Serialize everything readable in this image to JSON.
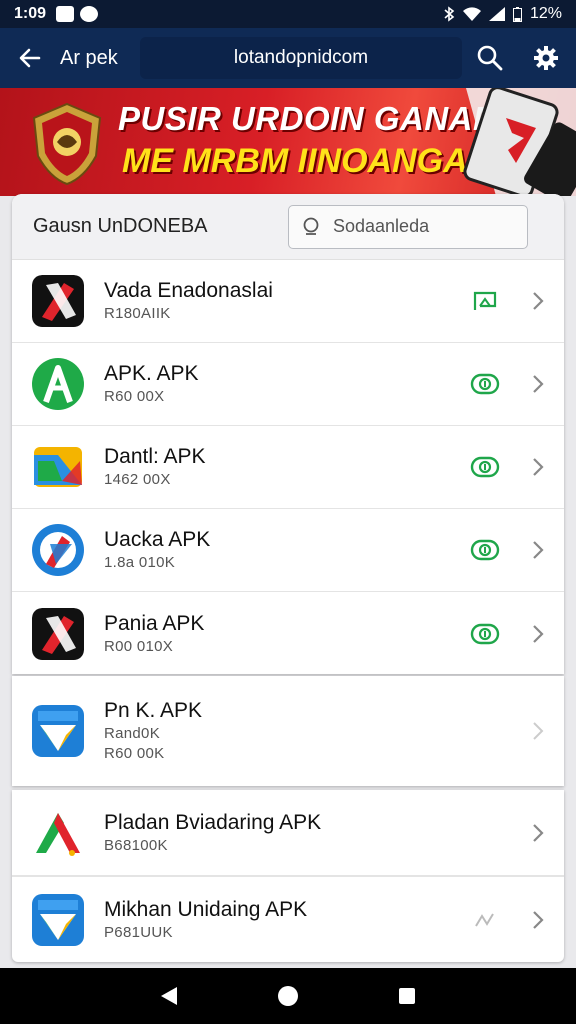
{
  "status_bar": {
    "time": "1:09",
    "battery": "12%"
  },
  "app_bar": {
    "title": "Ar pek",
    "url": "lotandopnidcom"
  },
  "banner": {
    "line1": "PUSIR URDOIN GANAN",
    "line2": "ME MRBM IINOANGA!"
  },
  "section": {
    "title": "Gausn UnDONEBA",
    "search_placeholder": "Sodaanleda"
  },
  "apps": [
    {
      "name": "Vada Enadonaslai",
      "sub": "R180AIIK",
      "icon": "red-x-app-icon",
      "action": "green-flag-icon"
    },
    {
      "name": "APK. APK",
      "sub": "R60 00X",
      "icon": "green-a-app-icon",
      "action": "green-download-icon"
    },
    {
      "name": "Dantl: APK",
      "sub": "1462 00X",
      "icon": "folder-drive-app-icon",
      "action": "green-download-icon"
    },
    {
      "name": "Uacka APK",
      "sub": "1.8a 010K",
      "icon": "blue-compass-app-icon",
      "action": "green-download-icon"
    },
    {
      "name": "Pania APK",
      "sub": "R00 010X",
      "icon": "red-x-app-icon",
      "action": "green-download-icon"
    }
  ],
  "featured": {
    "name": "Pn K. APK",
    "sub1": "Rand0K",
    "sub2": "R60 00K",
    "icon": "play-store-app-icon"
  },
  "more_apps": [
    {
      "name": "Pladan Bviadaring APK",
      "sub": "B68100K",
      "icon": "green-red-a-app-icon"
    },
    {
      "name": "Mikhan Unidaing APK",
      "sub": "P681UUK",
      "icon": "play-store-app-icon",
      "action": "grey-signal-icon"
    }
  ],
  "colors": {
    "app_bar": "#0f2a55",
    "status_bar": "#0c1a33",
    "accent_green": "#1fa64a",
    "banner_red": "#d81f26",
    "banner_yellow": "#ffe21a"
  }
}
